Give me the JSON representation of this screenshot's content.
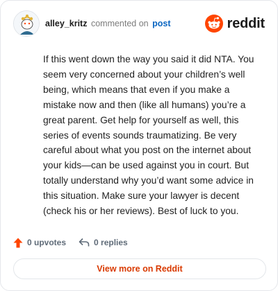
{
  "comment": {
    "username": "alley_kritz",
    "verb": "commented on",
    "target": "post",
    "body": "If this went down the way you said it did NTA. You seem very concerned about your children’s well being, which means that even if you make a mistake now and then (like all humans) you’re a great parent. Get help for yourself as well, this series of events sounds traumatizing. Be very careful about what you post on the internet about your kids—can be used against you in court. But totally understand why you’d want some advice in this situation. Make sure your lawyer is decent (check his or her reviews). Best of luck to you."
  },
  "brand": {
    "name": "reddit",
    "icon": "reddit-logo-icon",
    "color": "#ff4500"
  },
  "stats": {
    "upvotes_label": "0 upvotes",
    "replies_label": "0 replies",
    "upvote_icon": "upvote-arrow-icon",
    "reply_icon": "reply-arrow-icon",
    "upvote_color": "#ff4500"
  },
  "footer": {
    "view_more_label": "View more on Reddit"
  }
}
